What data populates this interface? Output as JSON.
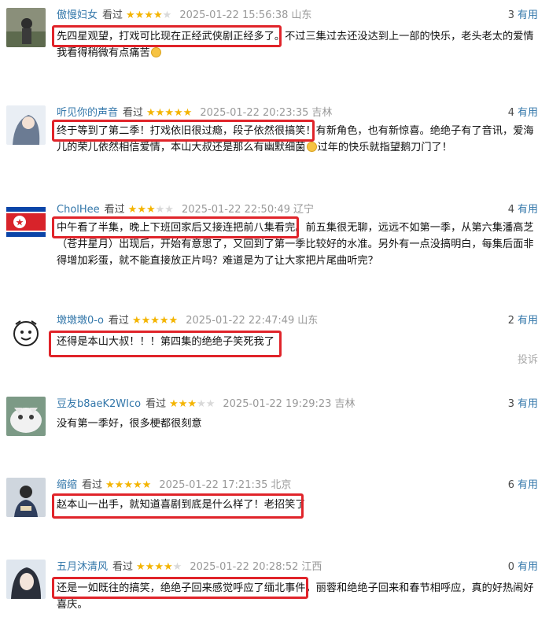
{
  "status_label": "看过",
  "useful_label": "有用",
  "report_label": "投诉",
  "comments": [
    {
      "user": "傲慢妇女",
      "rating": 4,
      "time": "2025-01-22 15:56:38",
      "location": "山东",
      "votes": "3",
      "text": "先四星观望，打戏可比现在正经武侠剧正经多了。不过三集过去还没达到上一部的快乐，老头老太的爱情我看得稍微有点痛苦"
    },
    {
      "user": "听见你的声音",
      "rating": 5,
      "time": "2025-01-22 20:23:35",
      "location": "吉林",
      "votes": "4",
      "text_a": "终于等到了第二季！打戏依旧很过瘾，段子依然很搞笑！有新角色，也有新惊喜。绝绝子有了音讯，爱海儿的荣儿依然相信爱情，本山大叔还是那么有幽默细菌",
      "text_b": "过年的快乐就指望鹅刀门了！"
    },
    {
      "user": "CholHee",
      "rating": 3,
      "time": "2025-01-22 22:50:49",
      "location": "辽宁",
      "votes": "4",
      "text": "中午看了半集，晚上下班回家后又接连把前八集看完。前五集很无聊，远远不如第一季，从第六集潘高芝（苍井星月）出现后，开始有意思了，又回到了第一季比较好的水准。另外有一点没搞明白，每集后面非得增加彩蛋，就不能直接放正片吗？难道是为了让大家把片尾曲听完？"
    },
    {
      "user": "墩墩墩0-o",
      "rating": 5,
      "time": "2025-01-22 22:47:49",
      "location": "山东",
      "votes": "2",
      "text": "还得是本山大叔！！！第四集的绝绝子笑死我了"
    },
    {
      "user": "豆友b8aeK2WIco",
      "rating": 3,
      "time": "2025-01-22 19:29:23",
      "location": "吉林",
      "votes": "3",
      "text": "没有第一季好，很多梗都很刻意"
    },
    {
      "user": "缩缩",
      "rating": 5,
      "time": "2025-01-22 17:21:35",
      "location": "北京",
      "votes": "6",
      "text": "赵本山一出手，就知道喜剧到底是什么样了！老招笑了"
    },
    {
      "user": "五月沐清风",
      "rating": 4,
      "time": "2025-01-22 20:28:52",
      "location": "江西",
      "votes": "0",
      "text": "还是一如既往的搞笑，绝绝子回来感觉呼应了缅北事件，丽蓉和绝绝子回来和春节相呼应，真的好热闹好喜庆。"
    }
  ]
}
